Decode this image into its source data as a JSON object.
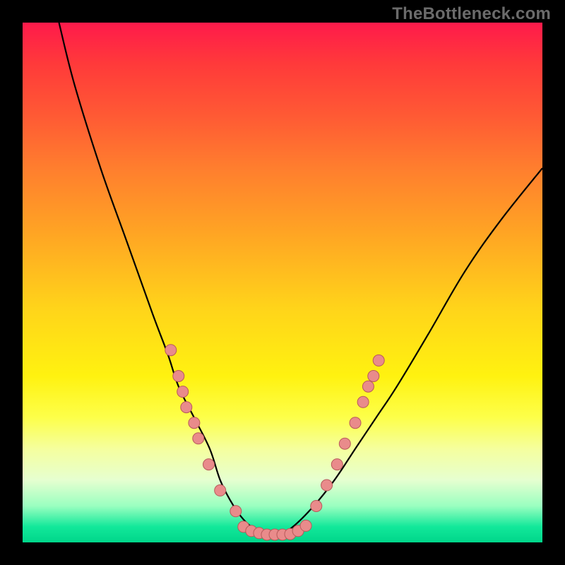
{
  "watermark": "TheBottleneck.com",
  "chart_data": {
    "type": "line",
    "title": "",
    "xlabel": "",
    "ylabel": "",
    "xlim": [
      0,
      100
    ],
    "ylim": [
      0,
      100
    ],
    "series": [
      {
        "name": "curve",
        "x": [
          7,
          10,
          15,
          20,
          25,
          28,
          30,
          33,
          36,
          38,
          40,
          42,
          44,
          46,
          48,
          50,
          52,
          56,
          60,
          64,
          68,
          72,
          78,
          85,
          92,
          100
        ],
        "y": [
          100,
          88,
          72,
          58,
          44,
          36,
          30,
          24,
          18,
          12,
          8,
          5,
          3,
          2,
          2,
          2,
          3,
          7,
          12,
          18,
          24,
          30,
          40,
          52,
          62,
          72
        ]
      }
    ],
    "scatter_points": {
      "left_cluster": [
        {
          "x": 28.5,
          "y": 37
        },
        {
          "x": 30.0,
          "y": 32
        },
        {
          "x": 30.8,
          "y": 29
        },
        {
          "x": 31.5,
          "y": 26
        },
        {
          "x": 33.0,
          "y": 23
        },
        {
          "x": 33.8,
          "y": 20
        },
        {
          "x": 35.8,
          "y": 15
        },
        {
          "x": 38.0,
          "y": 10
        },
        {
          "x": 41.0,
          "y": 6
        }
      ],
      "bottom_cluster": [
        {
          "x": 42.5,
          "y": 3.0
        },
        {
          "x": 44.0,
          "y": 2.2
        },
        {
          "x": 45.5,
          "y": 1.8
        },
        {
          "x": 47.0,
          "y": 1.5
        },
        {
          "x": 48.5,
          "y": 1.5
        },
        {
          "x": 50.0,
          "y": 1.5
        },
        {
          "x": 51.5,
          "y": 1.6
        },
        {
          "x": 53.0,
          "y": 2.2
        },
        {
          "x": 54.5,
          "y": 3.2
        }
      ],
      "right_cluster": [
        {
          "x": 56.5,
          "y": 7
        },
        {
          "x": 58.5,
          "y": 11
        },
        {
          "x": 60.5,
          "y": 15
        },
        {
          "x": 62.0,
          "y": 19
        },
        {
          "x": 64.0,
          "y": 23
        },
        {
          "x": 65.5,
          "y": 27
        },
        {
          "x": 66.5,
          "y": 30
        },
        {
          "x": 67.5,
          "y": 32
        },
        {
          "x": 68.5,
          "y": 35
        }
      ]
    },
    "colors": {
      "gradient_top": "#ff1a4b",
      "gradient_bottom": "#00d68a",
      "curve": "#000000",
      "points_fill": "#e98b8b",
      "points_stroke": "#b85a5a"
    }
  }
}
